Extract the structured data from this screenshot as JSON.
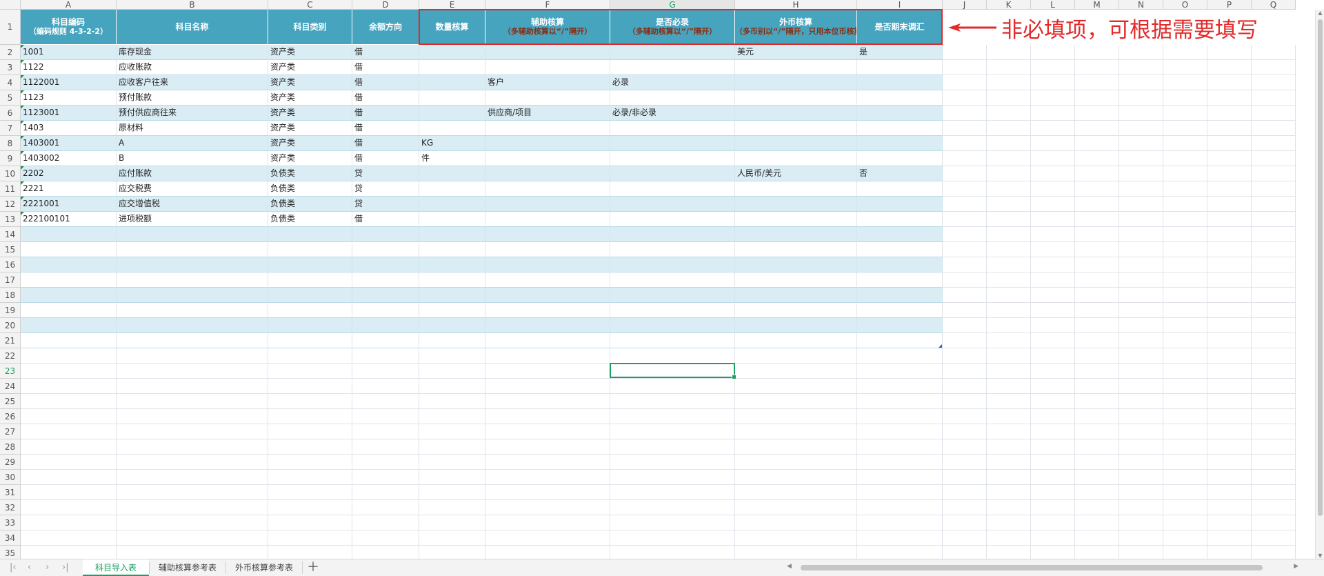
{
  "columns": [
    "A",
    "B",
    "C",
    "D",
    "E",
    "F",
    "G",
    "H",
    "I",
    "J",
    "K",
    "L",
    "M",
    "N",
    "O",
    "P",
    "Q"
  ],
  "selected_column": "G",
  "selected_row": "23",
  "header_row": [
    {
      "main": "科目编码",
      "sub": "（编码规则 4-3-2-2）"
    },
    {
      "main": "科目名称",
      "sub": ""
    },
    {
      "main": "科目类别",
      "sub": ""
    },
    {
      "main": "余额方向",
      "sub": ""
    },
    {
      "main": "数量核算",
      "sub": ""
    },
    {
      "main": "辅助核算",
      "sub": "（多辅助核算以“/”隔开）"
    },
    {
      "main": "是否必录",
      "sub": "（多辅助核算以“/”隔开）"
    },
    {
      "main": "外币核算",
      "sub": "（多币别以“/”隔开，只用本位币核算的不用录）"
    },
    {
      "main": "是否期末调汇",
      "sub": ""
    }
  ],
  "rows": [
    [
      "1001",
      "库存现金",
      "资产类",
      "借",
      "",
      "",
      "",
      "美元",
      "是"
    ],
    [
      "1122",
      "应收账款",
      "资产类",
      "借",
      "",
      "",
      "",
      "",
      ""
    ],
    [
      "1122001",
      "应收客户往来",
      "资产类",
      "借",
      "",
      "客户",
      "必录",
      "",
      ""
    ],
    [
      "1123",
      "预付账款",
      "资产类",
      "借",
      "",
      "",
      "",
      "",
      ""
    ],
    [
      "1123001",
      "预付供应商往来",
      "资产类",
      "借",
      "",
      "供应商/项目",
      "必录/非必录",
      "",
      ""
    ],
    [
      "1403",
      "原材料",
      "资产类",
      "借",
      "",
      "",
      "",
      "",
      ""
    ],
    [
      "1403001",
      "A",
      "资产类",
      "借",
      "KG",
      "",
      "",
      "",
      ""
    ],
    [
      "1403002",
      "B",
      "资产类",
      "借",
      "件",
      "",
      "",
      "",
      ""
    ],
    [
      "2202",
      "应付账款",
      "负债类",
      "贷",
      "",
      "",
      "",
      "人民币/美元",
      "否"
    ],
    [
      "2221",
      "应交税费",
      "负债类",
      "贷",
      "",
      "",
      "",
      "",
      ""
    ],
    [
      "2221001",
      "应交增值税",
      "负债类",
      "贷",
      "",
      "",
      "",
      "",
      ""
    ],
    [
      "222100101",
      "进项税额",
      "负债类",
      "借",
      "",
      "",
      "",
      "",
      ""
    ]
  ],
  "annotation": {
    "text": "非必填项，可根据需要填写",
    "color": "#e22a2a"
  },
  "sheet_tabs": [
    "科目导入表",
    "辅助核算参考表",
    "外币核算参考表"
  ],
  "active_tab": "科目导入表",
  "colors": {
    "header_bg": "#47a4bf",
    "band_bg": "#daedf4",
    "selection": "#1aa060",
    "sub_text": "#8b2d12"
  }
}
